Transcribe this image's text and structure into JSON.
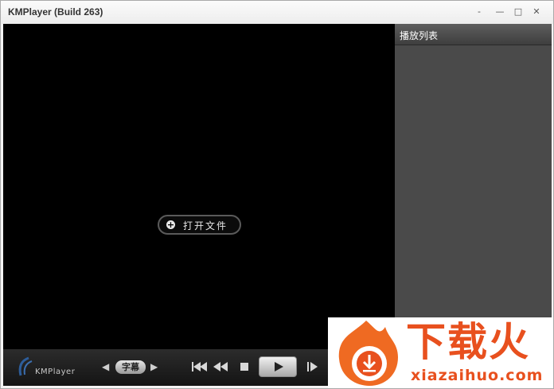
{
  "window": {
    "title": "KMPlayer (Build 263)",
    "minimize_glyph": "-",
    "hide_glyph": "—",
    "maximize_glyph": "□",
    "close_glyph": "✕"
  },
  "video": {
    "open_file_label": "打开文件",
    "open_file_icon": "plus-circle-icon"
  },
  "playlist": {
    "title": "播放列表"
  },
  "controls": {
    "logo_label": "KMPlayer",
    "subtitle_label": "字幕",
    "icons": [
      "prev-track-icon",
      "rewind-icon",
      "stop-icon",
      "play-icon",
      "next-frame-icon"
    ]
  },
  "watermark": {
    "title": "下载火",
    "url": "xiazaihuo.com"
  },
  "colors": {
    "video_bg": "#000000",
    "playlist_bg": "#4a4a4a",
    "watermark_accent": "#e8501e"
  }
}
